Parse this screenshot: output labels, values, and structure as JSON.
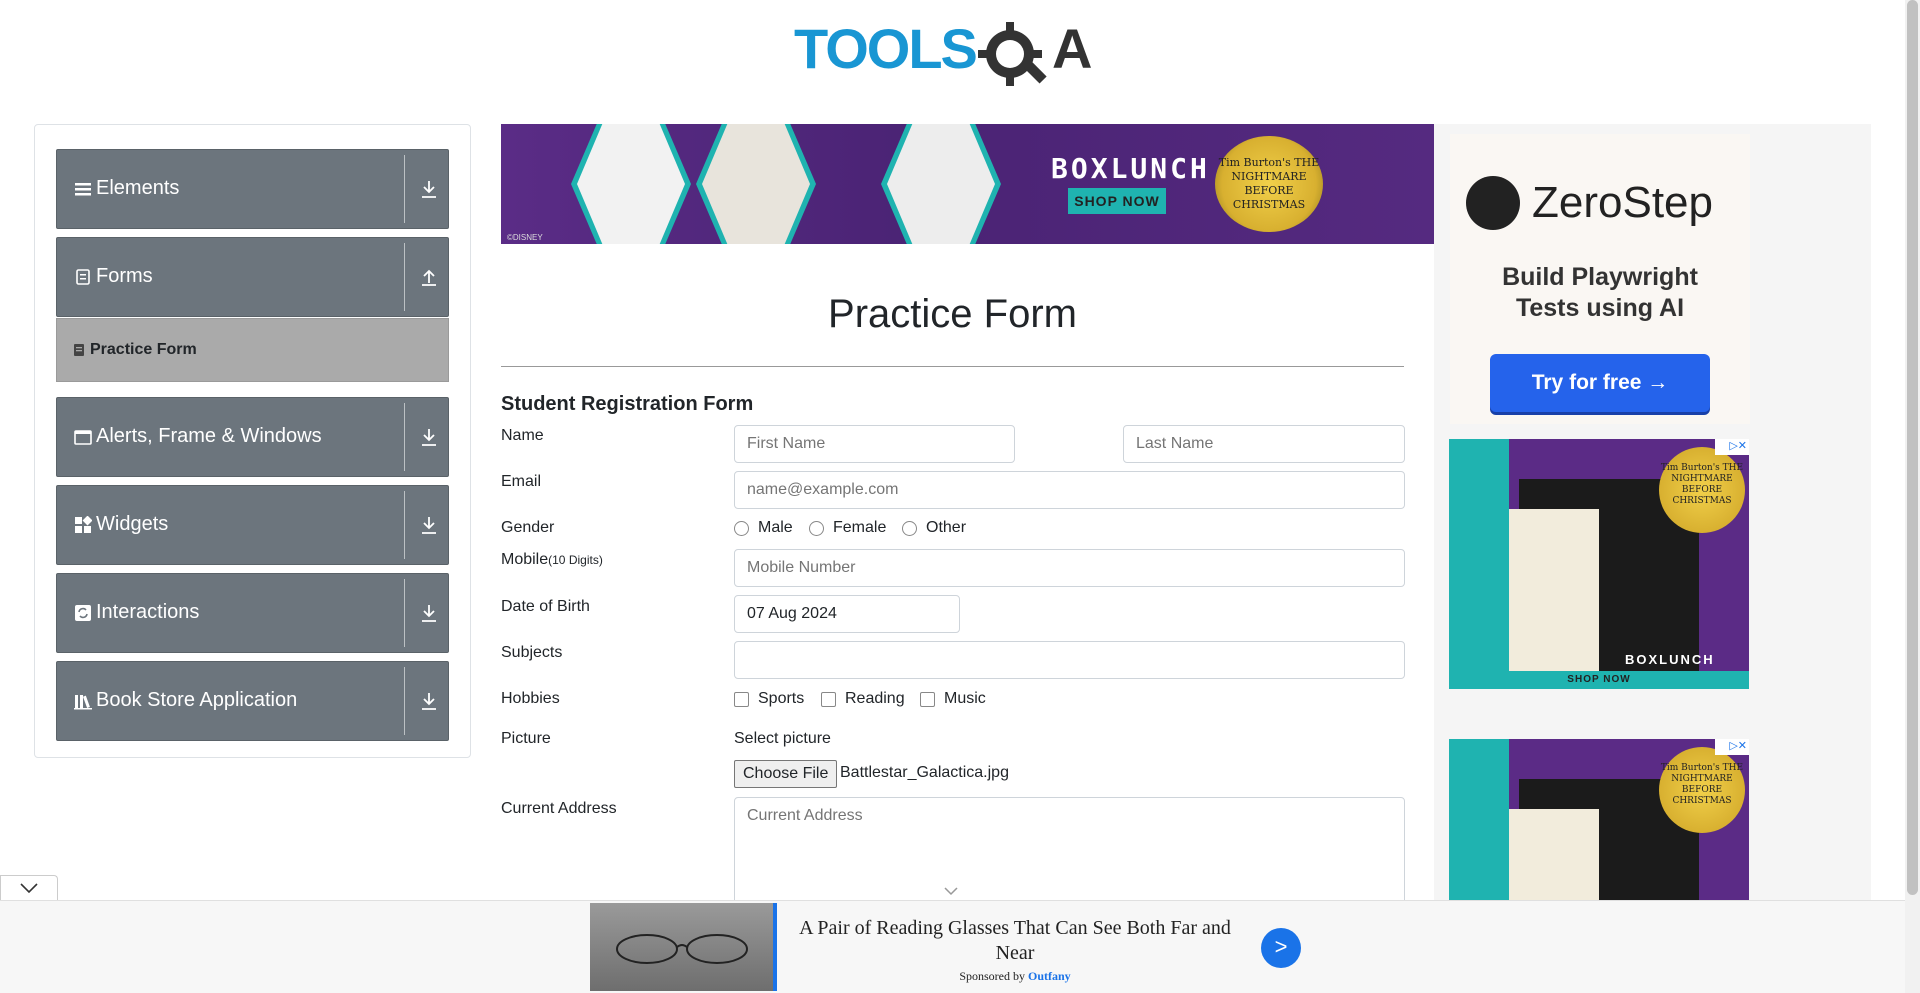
{
  "header": {
    "logo_text": "TOOLSQA"
  },
  "sidebar": {
    "groups": [
      {
        "label": "Elements",
        "icon": "menu-icon",
        "arrow": "expand-arrow-icon"
      },
      {
        "label": "Forms",
        "icon": "document-icon",
        "arrow": "collapse-arrow-icon"
      },
      {
        "label": "Alerts, Frame & Windows",
        "icon": "window-icon",
        "arrow": "expand-arrow-icon"
      },
      {
        "label": "Widgets",
        "icon": "grid-icon",
        "arrow": "expand-arrow-icon"
      },
      {
        "label": "Interactions",
        "icon": "refresh-icon",
        "arrow": "expand-arrow-icon"
      },
      {
        "label": "Book Store Application",
        "icon": "library-icon",
        "arrow": "expand-arrow-icon"
      }
    ],
    "active_item": {
      "label": "Practice Form",
      "icon": "document-small-icon"
    }
  },
  "banner_ad": {
    "brand": "BOXLUNCH",
    "cta": "SHOP NOW",
    "seal": "Tim Burton's THE NIGHTMARE BEFORE CHRISTMAS",
    "footer": "©DISNEY"
  },
  "right_ads": {
    "zerostep": {
      "name": "ZeroStep",
      "tagline": "Build Playwright Tests using AI",
      "cta": "Try for free →"
    },
    "box_ad": {
      "seal": "Tim Burton's THE NIGHTMARE BEFORE CHRISTMAS",
      "brand": "BOXLUNCH",
      "cta": "SHOP NOW",
      "close": "▷✕"
    }
  },
  "form": {
    "title": "Practice Form",
    "subtitle": "Student Registration Form",
    "labels": {
      "name": "Name",
      "email": "Email",
      "gender": "Gender",
      "mobile": "Mobile",
      "mobile_hint": "(10 Digits)",
      "dob": "Date of Birth",
      "subjects": "Subjects",
      "hobbies": "Hobbies",
      "picture": "Picture",
      "address": "Current Address"
    },
    "placeholders": {
      "first_name": "First Name",
      "last_name": "Last Name",
      "email": "name@example.com",
      "mobile": "Mobile Number",
      "address": "Current Address"
    },
    "gender_options": [
      "Male",
      "Female",
      "Other"
    ],
    "hobby_options": [
      "Sports",
      "Reading",
      "Music"
    ],
    "dob_value": "07 Aug 2024",
    "subjects_value": "",
    "select_picture": "Select picture",
    "choose_file": "Choose File",
    "file_name": "Battlestar_Galactica.jpg"
  },
  "bottom_ad": {
    "headline": "A Pair of Reading Glasses That Can See Both Far and Near",
    "sponsored_prefix": "Sponsored by",
    "sponsor": "Outfany",
    "go": ">"
  },
  "colors": {
    "sidebar_bg": "#6c757d",
    "active_item_bg": "#aaaaaa",
    "accent_blue": "#1a73e8",
    "toolsqa_blue": "#1996d3"
  }
}
